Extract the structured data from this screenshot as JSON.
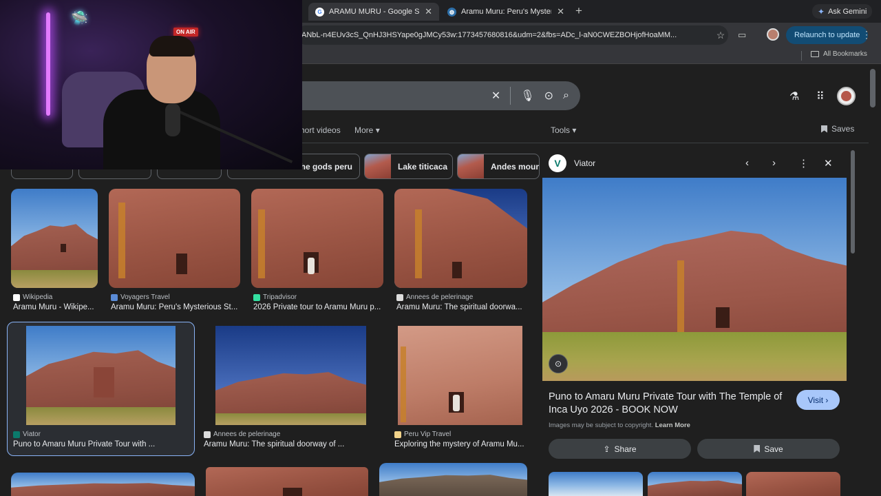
{
  "browser": {
    "tabs": [
      {
        "title": "ARAMU MURU - Google Search",
        "favicon": "google-icon",
        "active": true
      },
      {
        "title": "Aramu Muru: Peru's Mysterious",
        "favicon": "globe-icon",
        "active": false
      }
    ],
    "new_tab": "+",
    "ask_gemini": "Ask Gemini",
    "url": "ANbL-n4EUv3cS_QnHJ3HSYape0gJMCy53w:1773457680816&udm=2&fbs=ADc_l-aN0CWEZBOHjofHoaMM...",
    "relaunch": "Relaunch to update",
    "all_bookmarks": "All Bookmarks"
  },
  "google": {
    "nav": {
      "short_videos": "hort videos",
      "more": "More",
      "tools": "Tools",
      "saves": "Saves"
    },
    "chips": [
      {
        "label": "the gods peru"
      },
      {
        "label": "Lake titicaca"
      },
      {
        "label": "Andes mounta"
      }
    ],
    "results": [
      {
        "source": "Wikipedia",
        "title": "Aramu Muru - Wikipe..."
      },
      {
        "source": "Voyagers Travel",
        "title": "Aramu Muru: Peru's Mysterious St..."
      },
      {
        "source": "Tripadvisor",
        "title": "2026 Private tour to Aramu Muru p..."
      },
      {
        "source": "Annees de pelerinage",
        "title": "Aramu Muru: The spiritual doorwa..."
      },
      {
        "source": "Viator",
        "title": "Puno to Amaru Muru Private Tour with ..."
      },
      {
        "source": "Annees de pelerinage",
        "title": "Aramu Muru: The spiritual doorway of ..."
      },
      {
        "source": "Peru Vip Travel",
        "title": "Exploring the mystery of Aramu Mu..."
      }
    ]
  },
  "panel": {
    "site": "Viator",
    "title": "Puno to Amaru Muru Private Tour with The Temple of Inca Uyo 2026 - BOOK NOW",
    "visit": "Visit",
    "copyright": "Images may be subject to copyright.",
    "learn_more": "Learn More",
    "share": "Share",
    "save": "Save"
  },
  "webcam": {
    "sign": "ON AIR"
  },
  "colors": {
    "accent": "#a8c7fa",
    "relaunch_bg": "#124c74",
    "page_bg": "#1f1f1f"
  }
}
